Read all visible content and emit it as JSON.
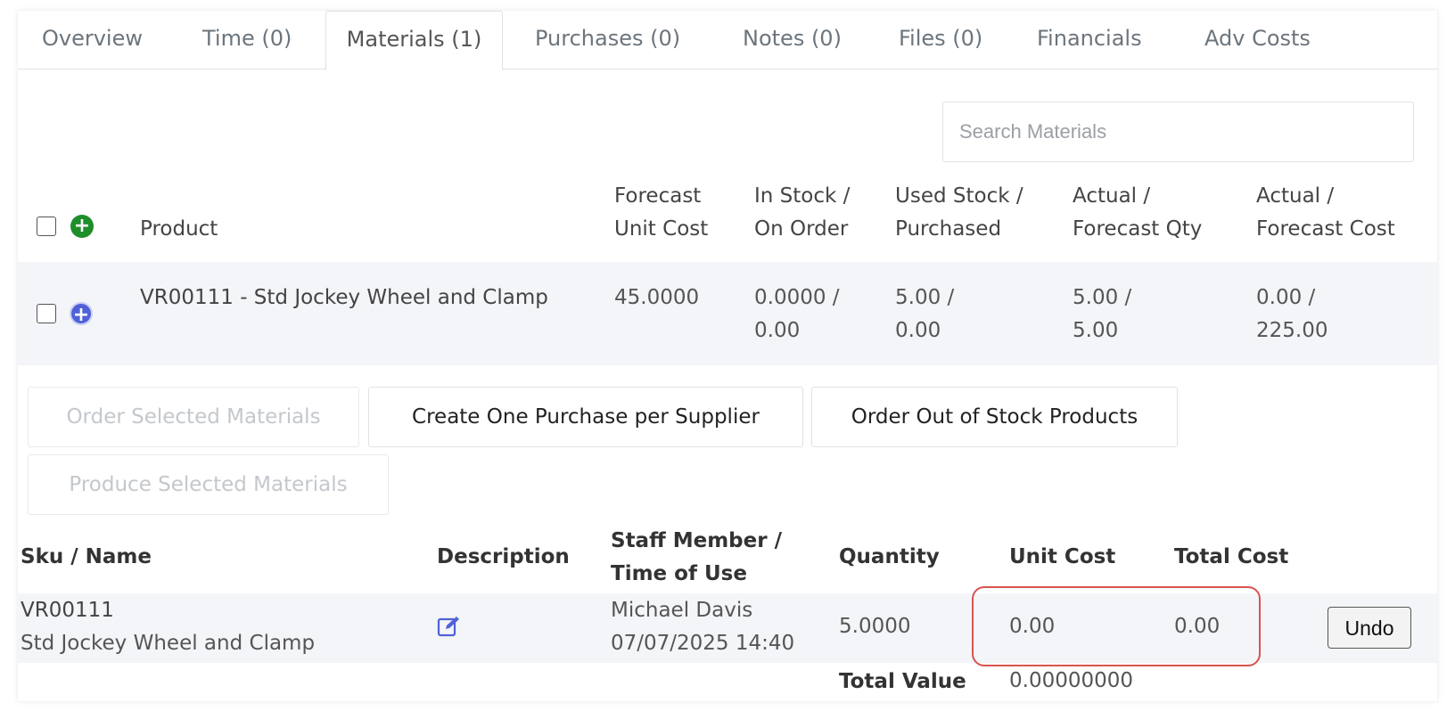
{
  "tabs": [
    {
      "label": "Overview"
    },
    {
      "label": "Time (0)"
    },
    {
      "label": "Materials (1)"
    },
    {
      "label": "Purchases (0)"
    },
    {
      "label": "Notes (0)"
    },
    {
      "label": "Files (0)"
    },
    {
      "label": "Financials"
    },
    {
      "label": "Adv Costs"
    }
  ],
  "search": {
    "placeholder": "Search Materials"
  },
  "materials_table": {
    "headers": {
      "product": "Product",
      "forecast_unit_cost_1": "Forecast",
      "forecast_unit_cost_2": "Unit Cost",
      "in_stock_1": "In Stock /",
      "in_stock_2": "On Order",
      "used_stock_1": "Used Stock /",
      "used_stock_2": "Purchased",
      "actual_qty_1": "Actual /",
      "actual_qty_2": "Forecast Qty",
      "actual_cost_1": "Actual /",
      "actual_cost_2": "Forecast Cost"
    },
    "row": {
      "product": "VR00111 - Std Jockey Wheel and Clamp",
      "forecast_unit_cost": "45.0000",
      "in_stock_1": "0.0000 /",
      "in_stock_2": "0.00",
      "used_stock_1": "5.00 /",
      "used_stock_2": "0.00",
      "actual_qty_1": "5.00 /",
      "actual_qty_2": "5.00",
      "actual_cost_1": "0.00 /",
      "actual_cost_2": "225.00"
    }
  },
  "actions": {
    "order_selected": "Order Selected Materials",
    "create_purchase": "Create One Purchase per Supplier",
    "order_out_of_stock": "Order Out of Stock Products",
    "produce_selected": "Produce Selected Materials"
  },
  "usage_table": {
    "headers": {
      "sku_name": "Sku / Name",
      "description": "Description",
      "staff_1": "Staff Member /",
      "staff_2": "Time of Use",
      "quantity": "Quantity",
      "unit_cost": "Unit Cost",
      "total_cost": "Total Cost"
    },
    "row": {
      "sku": "VR00111",
      "name": "Std Jockey Wheel and Clamp",
      "staff": "Michael Davis",
      "time": "07/07/2025 14:40",
      "quantity": "5.0000",
      "unit_cost": "0.00",
      "total_cost": "0.00",
      "undo_label": "Undo"
    },
    "total_label": "Total Value",
    "total_value": "0.00000000"
  },
  "colors": {
    "highlight": "#d9534f",
    "add_green": "#1e8e2a",
    "add_blue": "#5061d8",
    "edit_icon": "#5061d8"
  }
}
